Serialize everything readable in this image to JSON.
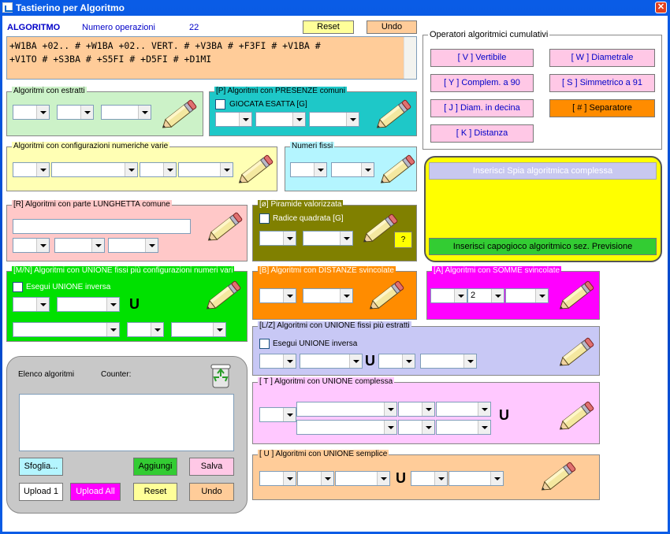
{
  "window": {
    "title": "Tastierino per Algoritmo",
    "close": "✕"
  },
  "header": {
    "algoritmo_label": "ALGORITMO",
    "numero_label": "Numero operazioni",
    "numero_value": "22",
    "reset": "Reset",
    "undo": "Undo"
  },
  "expression": "+W1BA +02.. # +W1BA +02.. VERT. # +V3BA # +F3FI # +V1BA #\n+V1TO # +S3BA # +S5FI # +D5FI # +D1MI",
  "cumulativi": {
    "title": "Operatori algoritmici cumulativi",
    "buttons": [
      "[ V ] Vertibile",
      "[ W ] Diametrale",
      "[ Y ] Complem. a 90",
      "[ S ] Simmetrico  a 91",
      "[ J ] Diam. in decina",
      "[ # ] Separatore",
      "[ K ] Distanza"
    ]
  },
  "groups": {
    "estratti": "Algoritmi con estratti",
    "presenze": "[P] Algoritmi con PRESENZE comuni",
    "giocata": "GIOCATA ESATTA  [G]",
    "config": "Algoritmi con configurazioni numeriche varie",
    "fissi": "Numeri fissi",
    "lunghetta": "[R] Algoritmi con parte LUNGHETTA comune",
    "piramide": "[ø] Piramide valorizzata",
    "radice": "Radice quadrata  [G]",
    "question": "?",
    "unione_mn": "[M/N] Algoritmi con UNIONE fissi più configurazioni numeri vari",
    "unione_inversa": "Esegui UNIONE inversa",
    "distanze": "[B] Algoritmi con DISTANZE svincolate",
    "somme": "[A] Algoritmi con SOMME svincolate",
    "somme_value": "2",
    "unione_lz": "[L/Z] Algoritmi con UNIONE fissi più estratti",
    "unione_lz_inversa": "Esegui UNIONE inversa",
    "complessa": "[ T ] Algoritmi con UNIONE complessa",
    "semplice": "[ U ] Algoritmi con UNIONE semplice",
    "u": "U"
  },
  "spia": {
    "inserisci_spia": "Inserisci Spia algoritmica complessa",
    "inserisci_capogioco": "Inserisci capogioco algoritmico sez. Previsione"
  },
  "elenco": {
    "title": "Elenco algoritmi",
    "counter": "Counter:",
    "buttons": {
      "sfoglia": "Sfoglia...",
      "aggiungi": "Aggiungi",
      "salva": "Salva",
      "upload1": "Upload 1",
      "upload_all": "Upload All",
      "reset": "Reset",
      "undo": "Undo"
    }
  },
  "colors": {
    "blue_label": "#0000c8",
    "orange_btn": "#ff8c00",
    "pink_btn": "#ffc8e6",
    "yellow": "#ffff00",
    "green": "#33cc33",
    "magenta": "#ff00ff"
  }
}
